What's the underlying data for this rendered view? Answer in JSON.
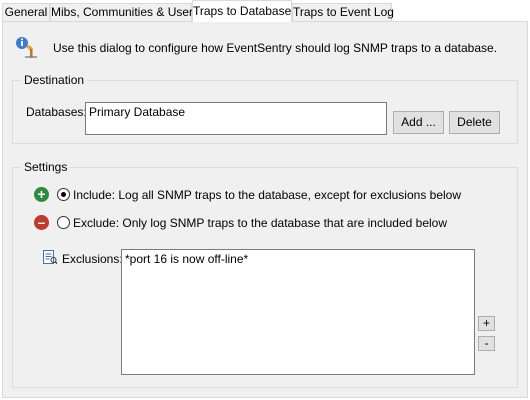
{
  "tabs": [
    {
      "label": "General"
    },
    {
      "label": "Mibs, Communities & Users"
    },
    {
      "label": "Traps to Database"
    },
    {
      "label": "Traps to Event Log"
    }
  ],
  "intro": {
    "text": "Use this dialog to configure how EventSentry should log SNMP traps to a database."
  },
  "destination": {
    "title": "Destination",
    "databases_label": "Databases:",
    "databases_value": "Primary Database",
    "add_label": "Add ...",
    "delete_label": "Delete"
  },
  "settings": {
    "title": "Settings",
    "include_label": "Include: Log all SNMP traps to the database, except for exclusions below",
    "exclude_label": "Exclude: Only log SNMP traps to the database that are included below",
    "exclusions_label": "Exclusions:",
    "exclusions_value": "*port 16 is now off-line*",
    "plus_label": "+",
    "minus_label": "-",
    "selected": "include"
  },
  "colors": {
    "include": "#2e8b3e",
    "exclude": "#c0392b"
  }
}
